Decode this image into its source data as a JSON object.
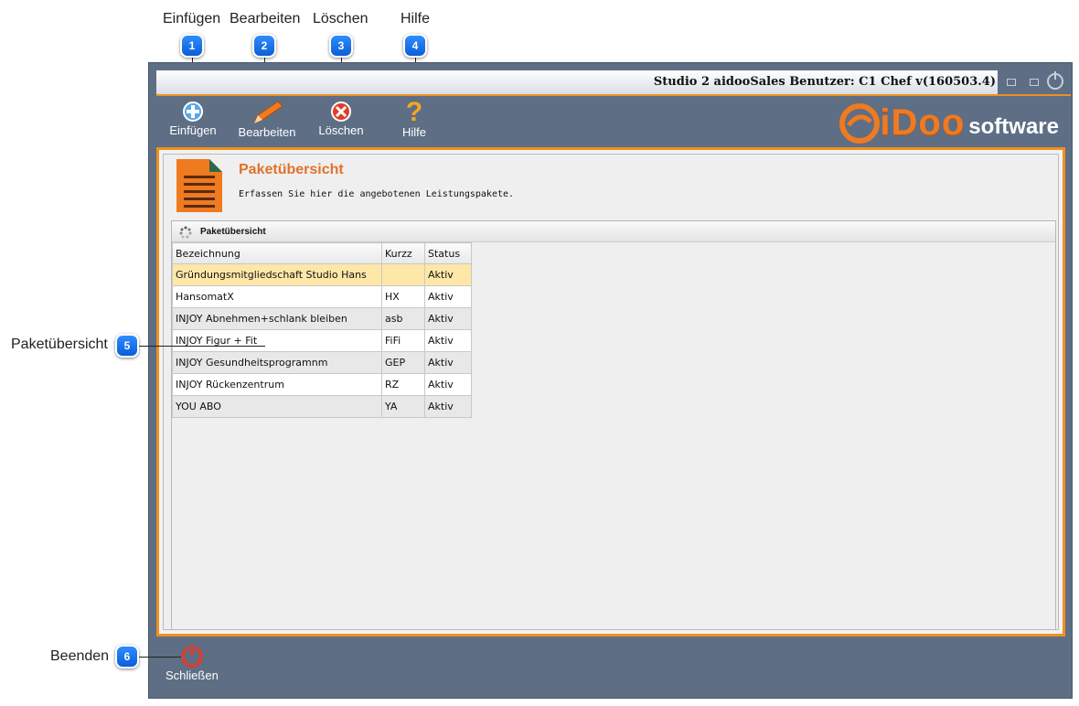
{
  "callouts": {
    "top": [
      {
        "num": "1",
        "label": "Einfügen"
      },
      {
        "num": "2",
        "label": "Bearbeiten"
      },
      {
        "num": "3",
        "label": "Löschen"
      },
      {
        "num": "4",
        "label": "Hilfe"
      }
    ],
    "left": [
      {
        "num": "5",
        "label": "Paketübersicht"
      },
      {
        "num": "6",
        "label": "Beenden"
      }
    ]
  },
  "window": {
    "title": "Studio 2 aidooSales Benutzer: C1 Chef v(160503.4)"
  },
  "toolbar": {
    "insert_label": "Einfügen",
    "edit_label": "Bearbeiten",
    "delete_label": "Löschen",
    "help_label": "Hilfe"
  },
  "logo": {
    "main": "iDoo",
    "suffix": "software"
  },
  "page": {
    "title": "Paketübersicht",
    "subtitle": "Erfassen Sie hier die angebotenen Leistungspakete."
  },
  "grid": {
    "title": "Paketübersicht",
    "columns": [
      "Bezeichnung",
      "Kurzz",
      "Status"
    ],
    "rows": [
      [
        "Gründungsmitgliedschaft Studio Hans",
        "",
        "Aktiv"
      ],
      [
        "HansomatX",
        "HX",
        "Aktiv"
      ],
      [
        "INJOY Abnehmen+schlank bleiben",
        "asb",
        "Aktiv"
      ],
      [
        "INJOY Figur + Fit",
        "FiFi",
        "Aktiv"
      ],
      [
        "INJOY Gesundheitsprogramnm",
        "GEP",
        "Aktiv"
      ],
      [
        "INJOY Rückenzentrum",
        "RZ",
        "Aktiv"
      ],
      [
        "YOU ABO",
        "YA",
        "Aktiv"
      ]
    ]
  },
  "footer": {
    "close_label": "Schließen"
  },
  "colors": {
    "accent": "#f09020",
    "panel": "#5e6e85",
    "title_orange": "#e2722a",
    "badge_blue": "#1a73e8"
  }
}
